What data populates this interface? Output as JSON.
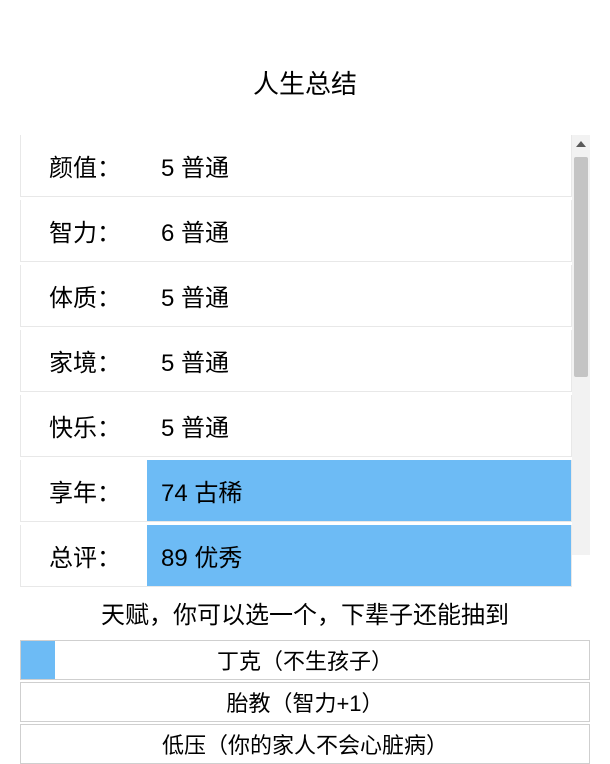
{
  "title": "人生总结",
  "stats": [
    {
      "label": "颜值：",
      "value": "5 普通",
      "highlight": false
    },
    {
      "label": "智力：",
      "value": "6 普通",
      "highlight": false
    },
    {
      "label": "体质：",
      "value": "5 普通",
      "highlight": false
    },
    {
      "label": "家境：",
      "value": "5 普通",
      "highlight": false
    },
    {
      "label": "快乐：",
      "value": "5 普通",
      "highlight": false
    },
    {
      "label": "享年：",
      "value": "74 古稀",
      "highlight": true
    },
    {
      "label": "总评：",
      "value": "89 优秀",
      "highlight": true
    }
  ],
  "talentTitle": "天赋，你可以选一个，下辈子还能抽到",
  "talents": [
    {
      "name": "丁克（不生孩子）",
      "selected": true
    },
    {
      "name": "胎教（智力+1）",
      "selected": false
    },
    {
      "name": "低压（你的家人不会心脏病）",
      "selected": false
    }
  ]
}
